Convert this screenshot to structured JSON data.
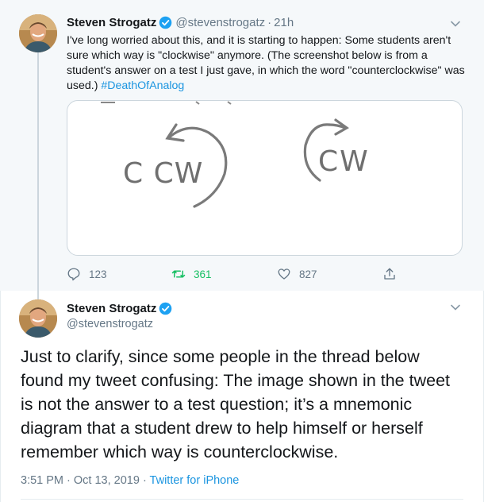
{
  "colors": {
    "link": "#1b95e0",
    "verified": "#1da1f2",
    "retweet_active": "#17bf63",
    "muted": "#657786"
  },
  "parent_tweet": {
    "author_name": "Steven Strogatz",
    "author_handle": "@stevenstrogatz",
    "separator": "·",
    "time": "21h",
    "text": "I've long worried about this, and it is starting to happen: Some  students aren't sure which way is \"clockwise\" anymore. (The screenshot below is from a student's answer on a test I just gave, in which the word \"counterclockwise\" was used.) ",
    "hashtag": "#DeathOfAnalog",
    "media": {
      "left_label": "C CW",
      "right_label": "CW"
    },
    "icons": [
      "reply-icon",
      "retweet-icon",
      "like-icon",
      "share-icon",
      "verified-icon",
      "chevron-down-icon"
    ],
    "actions": {
      "replies": "123",
      "retweets": "361",
      "likes": "827"
    }
  },
  "focused_tweet": {
    "author_name": "Steven Strogatz",
    "author_handle": "@stevenstrogatz",
    "text": "Just to clarify, since some people in the thread below found my tweet confusing: The image shown in the tweet is not the answer to a test question; it’s a mnemonic diagram that a student drew to help himself or herself remember which way is counterclockwise.",
    "timestamp": "3:51 PM · Oct 13, 2019 · ",
    "source": "Twitter for iPhone"
  }
}
